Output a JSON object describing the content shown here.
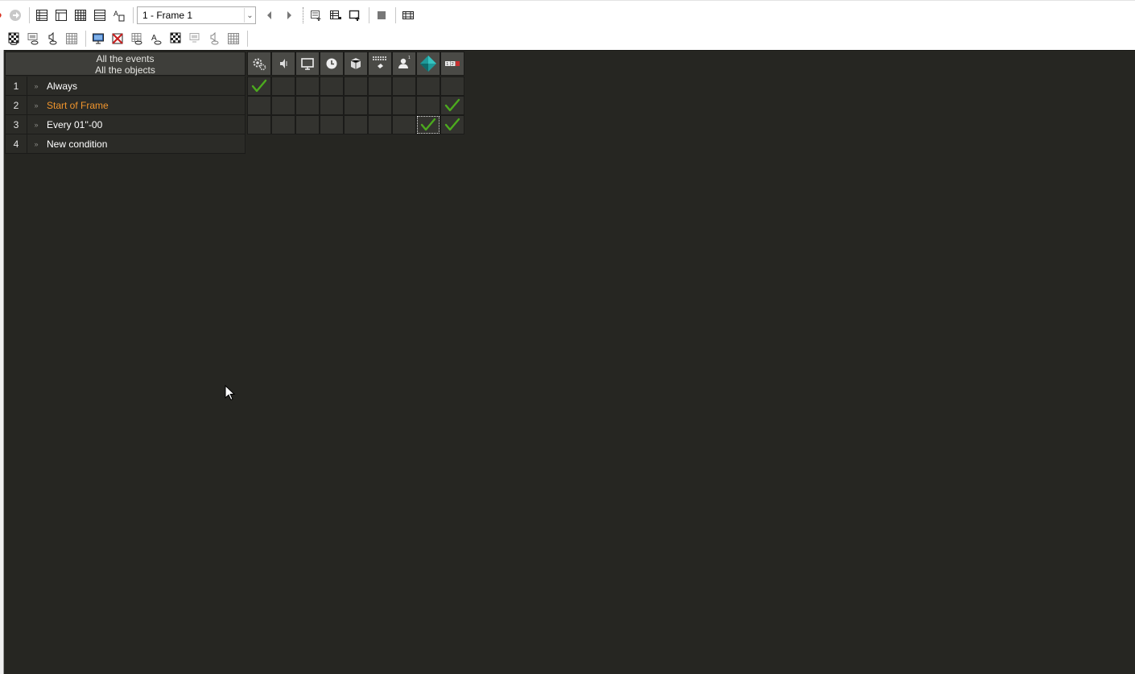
{
  "toolbar": {
    "frame_select": {
      "value": "1 - Frame 1"
    },
    "row1_icons": [
      "record-icon",
      "forward-icon",
      "event-list-icon",
      "layout-icon",
      "grid-view-icon",
      "list-view-icon",
      "text-icon"
    ],
    "row1_right_icons": [
      "previous-frame-icon",
      "next-frame-icon",
      "insert-icon",
      "insert-row-icon",
      "insert-frame-icon",
      "stop-icon",
      "film-icon"
    ],
    "row2_icons": [
      "eye-icon",
      "checker-icon",
      "monitor-eye-icon",
      "speaker-eye-icon",
      "grid-icon",
      "display-icon",
      "crossed-icon",
      "grid-eye-icon",
      "text-eye-icon",
      "checker-eye-icon",
      "monitor-small-icon",
      "speaker-small-icon",
      "grid-small-icon"
    ]
  },
  "events": {
    "header_line1": "All the events",
    "header_line2": "All the objects",
    "rows": [
      {
        "num": "1",
        "arrow": "»",
        "text": "Always",
        "special": false
      },
      {
        "num": "2",
        "arrow": "»",
        "text": "Start of Frame",
        "special": true
      },
      {
        "num": "3",
        "arrow": "»",
        "text": "Every 01''-00",
        "special": false
      },
      {
        "num": "4",
        "arrow": "»",
        "text": "New condition",
        "special": false
      }
    ]
  },
  "objects": [
    "special-gear-icon",
    "sound-icon",
    "storyboard-monitor-icon",
    "timer-clock-icon",
    "create-object-cube-icon",
    "keyboard-mouse-icon",
    "player-icon",
    "active-diamond-icon",
    "counter-icon"
  ],
  "checks": [
    [
      true,
      false,
      false,
      false,
      false,
      false,
      false,
      false,
      false
    ],
    [
      false,
      false,
      false,
      false,
      false,
      false,
      false,
      false,
      true
    ],
    [
      false,
      false,
      false,
      false,
      false,
      false,
      false,
      true,
      true
    ]
  ],
  "selected_cell": {
    "row": 3,
    "col": 8
  },
  "colors": {
    "background": "#262622",
    "check": "#4caa1e",
    "special_event": "#f0952d"
  }
}
